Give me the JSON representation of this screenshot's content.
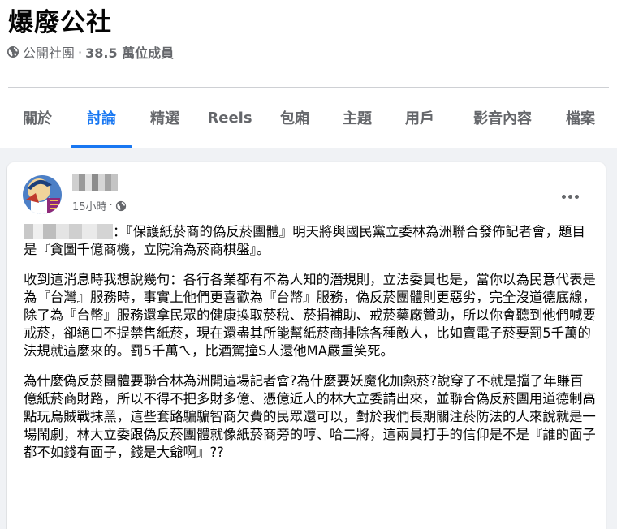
{
  "group": {
    "name": "爆廢公社",
    "privacy": "公開社團",
    "separator": "·",
    "members": "38.5 萬位成員"
  },
  "tabs": [
    {
      "label": "關於"
    },
    {
      "label": "討論",
      "active": true
    },
    {
      "label": "精選"
    },
    {
      "label": "Reels"
    },
    {
      "label": "包廂"
    },
    {
      "label": "主題"
    },
    {
      "label": "用戶"
    },
    {
      "label": "影音內容"
    },
    {
      "label": "檔案"
    }
  ],
  "post": {
    "timestamp": "15小時",
    "separator": "·",
    "paragraphs": [
      "：『保護紙菸商的偽反菸團體』明天將與國民黨立委林為洲聯合發佈記者會，題目是『貪圖千億商機，立院淪為菸商棋盤』。",
      "收到這消息時我想說幾句：各行各業都有不為人知的潛規則，立法委員也是，當你以為民意代表是為『台灣』服務時，事實上他們更喜歡為『台幣』服務，偽反菸團體則更惡劣，完全沒道德底線，除了為『台幣』服務還拿民眾的健康換取菸稅、菸捐補助、戒菸藥廠贊助，所以你會聽到他們喊要戒菸，卻絕口不提禁售紙菸，現在還盡其所能幫紙菸商排除各種敵人，比如賣電子菸要罰5千萬的法規就這麼來的。罰5千萬ㄟ，比酒駕撞S人還他MA嚴重笑死。",
      "為什麼偽反菸團體要聯合林為洲開這場記者會?為什麼要妖魔化加熱菸?說穿了不就是擋了年賺百億紙菸商財路，所以不得不把多財多億、憑億近人的林大立委請出來，並聯合偽反菸團用道德制高點玩烏賊戰抹黑，這些套路騙騙智商欠費的民眾還可以，對於我們長期關注菸防法的人來說就是一場鬧劇，林大立委跟偽反菸團體就像紙菸商旁的哼、哈二將，這兩員打手的信仰是不是『誰的面子都不如錢有面子，錢是大爺啊』??"
    ]
  },
  "icons": {
    "privacy": "globe-icon",
    "audience": "globe-icon",
    "more": "more-options-icon"
  },
  "colors": {
    "accent": "#1877f2",
    "muted": "#65676b"
  }
}
